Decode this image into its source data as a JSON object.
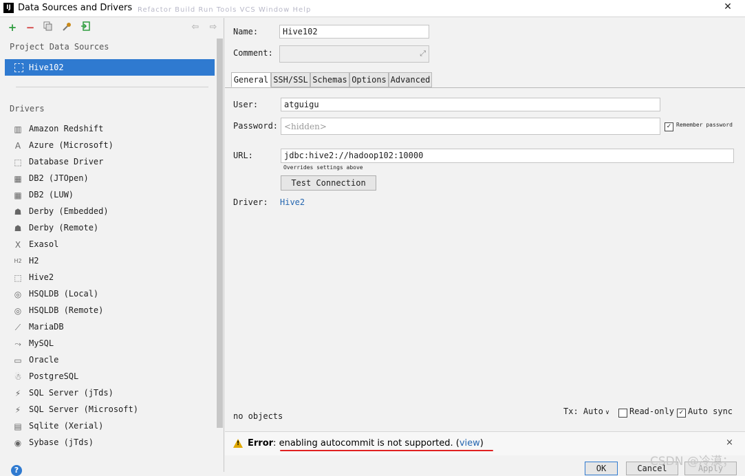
{
  "window": {
    "title": "Data Sources and Drivers",
    "app_icon_text": "IJ",
    "close": "✕",
    "ghost_menu": "Refactor Build Run Tools VCS Window Help"
  },
  "left": {
    "project_label": "Project Data Sources",
    "datasources": [
      {
        "label": "Hive102"
      }
    ],
    "drivers_label": "Drivers",
    "drivers": [
      {
        "label": "Amazon Redshift",
        "icon": "redshift-icon",
        "glyph": "▥"
      },
      {
        "label": "Azure (Microsoft)",
        "icon": "azure-icon",
        "glyph": "A"
      },
      {
        "label": "Database Driver",
        "icon": "database-driver-icon",
        "glyph": "⬚"
      },
      {
        "label": "DB2 (JTOpen)",
        "icon": "db2-icon",
        "glyph": "▦"
      },
      {
        "label": "DB2 (LUW)",
        "icon": "db2-icon",
        "glyph": "▦"
      },
      {
        "label": "Derby (Embedded)",
        "icon": "derby-icon",
        "glyph": "☗"
      },
      {
        "label": "Derby (Remote)",
        "icon": "derby-icon",
        "glyph": "☗"
      },
      {
        "label": "Exasol",
        "icon": "exasol-icon",
        "glyph": "X"
      },
      {
        "label": "H2",
        "icon": "h2-icon",
        "glyph": "H2"
      },
      {
        "label": "Hive2",
        "icon": "hive-icon",
        "glyph": "⬚"
      },
      {
        "label": "HSQLDB (Local)",
        "icon": "hsqldb-icon",
        "glyph": "◎"
      },
      {
        "label": "HSQLDB (Remote)",
        "icon": "hsqldb-icon",
        "glyph": "◎"
      },
      {
        "label": "MariaDB",
        "icon": "mariadb-icon",
        "glyph": "⟋"
      },
      {
        "label": "MySQL",
        "icon": "mysql-icon",
        "glyph": "⤳"
      },
      {
        "label": "Oracle",
        "icon": "oracle-icon",
        "glyph": "▭"
      },
      {
        "label": "PostgreSQL",
        "icon": "postgresql-icon",
        "glyph": "☃"
      },
      {
        "label": "SQL Server (jTds)",
        "icon": "sqlserver-icon",
        "glyph": "⚡"
      },
      {
        "label": "SQL Server (Microsoft)",
        "icon": "sqlserver-icon",
        "glyph": "⚡"
      },
      {
        "label": "Sqlite (Xerial)",
        "icon": "sqlite-icon",
        "glyph": "▤"
      },
      {
        "label": "Sybase (jTds)",
        "icon": "sybase-icon",
        "glyph": "◉"
      }
    ],
    "help": "?"
  },
  "form": {
    "name_label": "Name:",
    "name_value": "Hive102",
    "comment_label": "Comment:",
    "comment_value": "",
    "tabs": [
      "General",
      "SSH/SSL",
      "Schemas",
      "Options",
      "Advanced"
    ],
    "active_tab": "General",
    "user_label": "User:",
    "user_value": "atguigu",
    "password_label": "Password:",
    "password_placeholder": "<hidden>",
    "remember_label": "Remember password",
    "remember_checked": true,
    "url_label": "URL:",
    "url_value": "jdbc:hive2://hadoop102:10000",
    "url_hint": "Overrides settings above",
    "test_button": "Test Connection",
    "driver_label": "Driver:",
    "driver_value": "Hive2",
    "objects": "no objects",
    "tx_label": "Tx: Auto",
    "readonly_label": "Read-only",
    "readonly_checked": false,
    "autosync_label": "Auto sync",
    "autosync_checked": true
  },
  "error": {
    "prefix": "Error",
    "sep": ":",
    "message": "enabling autocommit is not supported.",
    "open": "(",
    "link": "view",
    "close_paren": ")",
    "close": "×"
  },
  "footer": {
    "ok": "OK",
    "cancel": "Cancel",
    "apply": "Apply"
  },
  "watermark": "CSDN @冷漠；"
}
